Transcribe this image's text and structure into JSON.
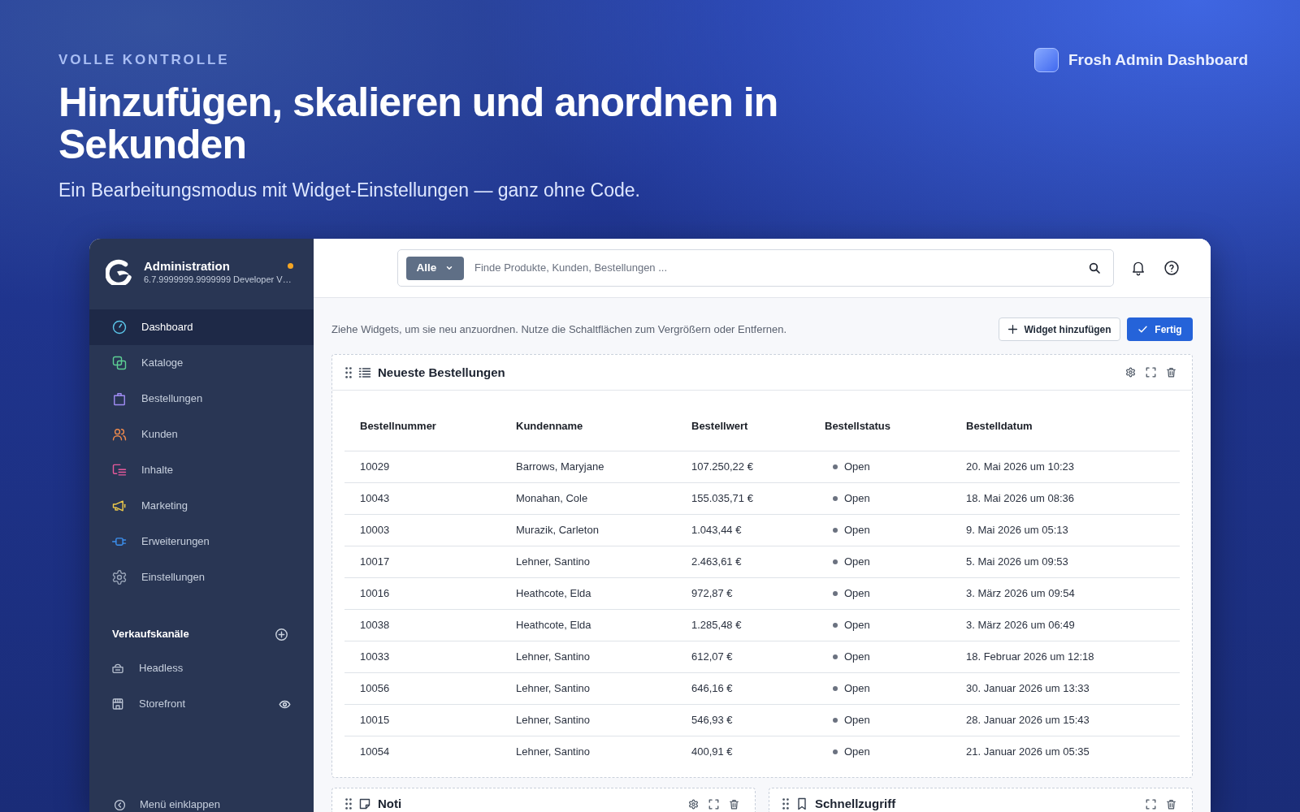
{
  "hero": {
    "eyebrow": "VOLLE KONTROLLE",
    "title": "Hinzufügen, skalieren und anordnen in Sekunden",
    "subtitle": "Ein Bearbeitungsmodus mit Widget-Einstellungen — ganz ohne Code.",
    "brand": "Frosh Admin Dashboard"
  },
  "sidebar": {
    "title": "Administration",
    "version": "6.7.9999999.9999999 Developer V…",
    "nav": [
      {
        "label": "Dashboard",
        "selected": true
      },
      {
        "label": "Kataloge",
        "selected": false
      },
      {
        "label": "Bestellungen",
        "selected": false
      },
      {
        "label": "Kunden",
        "selected": false
      },
      {
        "label": "Inhalte",
        "selected": false
      },
      {
        "label": "Marketing",
        "selected": false
      },
      {
        "label": "Erweiterungen",
        "selected": false
      },
      {
        "label": "Einstellungen",
        "selected": false
      }
    ],
    "sales_channels": {
      "title": "Verkaufskanäle",
      "items": [
        {
          "label": "Headless",
          "kind": "headless"
        },
        {
          "label": "Storefront",
          "kind": "storefront"
        }
      ]
    },
    "collapse": "Menü einklappen"
  },
  "topbar": {
    "search": {
      "scope": "Alle",
      "placeholder": "Finde Produkte, Kunden, Bestellungen ..."
    }
  },
  "toolbar": {
    "hint": "Ziehe Widgets, um sie neu anzuordnen. Nutze die Schaltflächen zum Vergrößern oder Entfernen.",
    "buttons": [
      {
        "label": "Widget hinzufügen",
        "kind": "secondary"
      },
      {
        "label": "Fertig",
        "kind": "primary"
      }
    ]
  },
  "widgets": [
    {
      "title": "Neueste Bestellungen",
      "configurable": true,
      "table": {
        "columns": [
          "Bestellnummer",
          "Kundenname",
          "Bestellwert",
          "Bestellstatus",
          "Bestelldatum"
        ],
        "rows": [
          {
            "number": "10029",
            "customer": "Barrows, Maryjane",
            "amount": "107.250,22 €",
            "status": "Open",
            "color": "#6b7280",
            "date": "20. Mai 2026 um 10:23"
          },
          {
            "number": "10043",
            "customer": "Monahan, Cole",
            "amount": "155.035,71 €",
            "status": "Open",
            "color": "#6b7280",
            "date": "18. Mai 2026 um 08:36"
          },
          {
            "number": "10003",
            "customer": "Murazik, Carleton",
            "amount": "1.043,44 €",
            "status": "Open",
            "color": "#6b7280",
            "date": "9. Mai 2026 um 05:13"
          },
          {
            "number": "10017",
            "customer": "Lehner, Santino",
            "amount": "2.463,61 €",
            "status": "Open",
            "color": "#6b7280",
            "date": "5. Mai 2026 um 09:53"
          },
          {
            "number": "10016",
            "customer": "Heathcote, Elda",
            "amount": "972,87 €",
            "status": "Open",
            "color": "#6b7280",
            "date": "3. März 2026 um 09:54"
          },
          {
            "number": "10038",
            "customer": "Heathcote, Elda",
            "amount": "1.285,48 €",
            "status": "Open",
            "color": "#6b7280",
            "date": "3. März 2026 um 06:49"
          },
          {
            "number": "10033",
            "customer": "Lehner, Santino",
            "amount": "612,07 €",
            "status": "Open",
            "color": "#6b7280",
            "date": "18. Februar 2026 um 12:18"
          },
          {
            "number": "10056",
            "customer": "Lehner, Santino",
            "amount": "646,16 €",
            "status": "Open",
            "color": "#6b7280",
            "date": "30. Januar 2026 um 13:33"
          },
          {
            "number": "10015",
            "customer": "Lehner, Santino",
            "amount": "546,93 €",
            "status": "Open",
            "color": "#6b7280",
            "date": "28. Januar 2026 um 15:43"
          },
          {
            "number": "10054",
            "customer": "Lehner, Santino",
            "amount": "400,91 €",
            "status": "Open",
            "color": "#6b7280",
            "date": "21. Januar 2026 um 05:35"
          }
        ]
      }
    },
    {
      "title": "Noti",
      "configurable": true
    },
    {
      "title": "Schnellzugriff",
      "configurable": false
    }
  ]
}
